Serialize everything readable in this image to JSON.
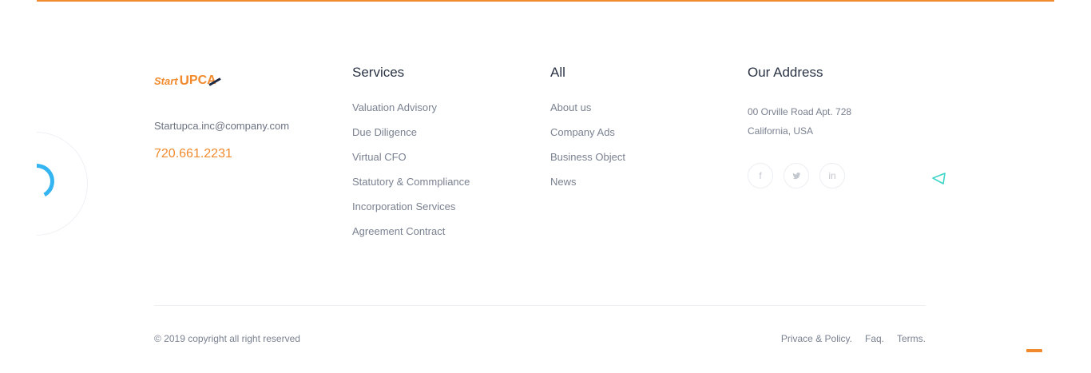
{
  "brand": {
    "logo_start": "Start",
    "logo_u": "U",
    "logo_pca": "PCA",
    "email": "Startupca.inc@company.com",
    "phone": "720.661.2231"
  },
  "services": {
    "title": "Services",
    "items": [
      "Valuation Advisory",
      "Due Diligence",
      "Virtual CFO",
      "Statutory & Commpliance",
      "Incorporation Services",
      "Agreement Contract"
    ]
  },
  "all": {
    "title": "All",
    "items": [
      "About us",
      "Company Ads",
      "Business Object",
      "News"
    ]
  },
  "address": {
    "title": "Our Address",
    "line1": "00 Orville Road Apt. 728",
    "line2": "California, USA",
    "social": [
      {
        "icon": "facebook-icon",
        "glyph": "f"
      },
      {
        "icon": "twitter-icon",
        "glyph": "ᵛ"
      },
      {
        "icon": "linkedin-icon",
        "glyph": "in"
      }
    ]
  },
  "footer": {
    "copyright": "© 2019 copyright all right reserved",
    "links": [
      "Privace & Policy.",
      "Faq.",
      "Terms."
    ]
  },
  "colors": {
    "accent": "#f08a2c",
    "heading": "#2b3445",
    "decor_blue": "#34b4f0",
    "decor_teal": "#3ed6c8"
  }
}
